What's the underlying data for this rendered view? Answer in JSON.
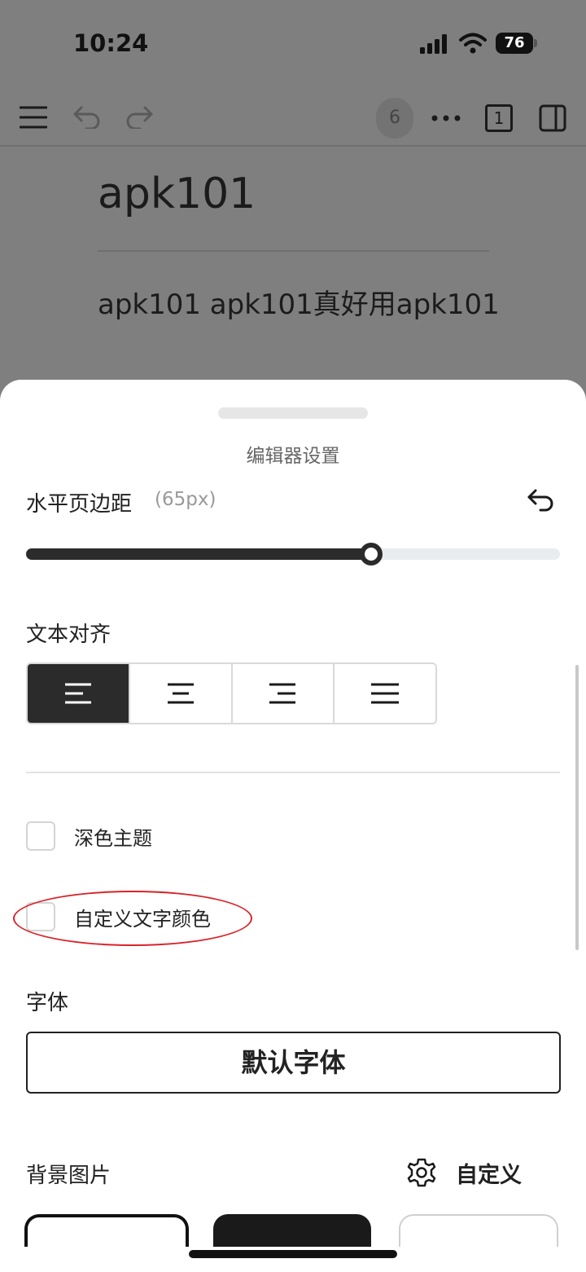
{
  "status_bar": {
    "time": "10:24",
    "battery": "76"
  },
  "toolbar": {
    "count_badge": "6",
    "page_indicator": "1",
    "icons": [
      "menu-icon",
      "undo-icon",
      "redo-icon",
      "more-icon",
      "page-icon",
      "sidebar-toggle-icon"
    ]
  },
  "document": {
    "title": "apk101",
    "body": "apk101 apk101真好用apk101"
  },
  "settings_sheet": {
    "title": "编辑器设置",
    "margin": {
      "label": "水平页边距",
      "value": "(65px)",
      "slider_fraction": 0.646
    },
    "text_align": {
      "label": "文本对齐",
      "options": [
        "align-left",
        "align-center",
        "align-right",
        "align-justify"
      ],
      "selected": "align-left"
    },
    "dark_theme": {
      "label": "深色主题",
      "checked": false
    },
    "custom_text_color": {
      "label": "自定义文字颜色",
      "checked": false
    },
    "font": {
      "label": "字体",
      "value": "默认字体"
    },
    "background_image": {
      "label": "背景图片",
      "custom_label": "自定义"
    }
  },
  "colors": {
    "overlay": "#7f7f7f",
    "accent_dark": "#2b2b2b",
    "annotation_red": "#d8232a"
  }
}
